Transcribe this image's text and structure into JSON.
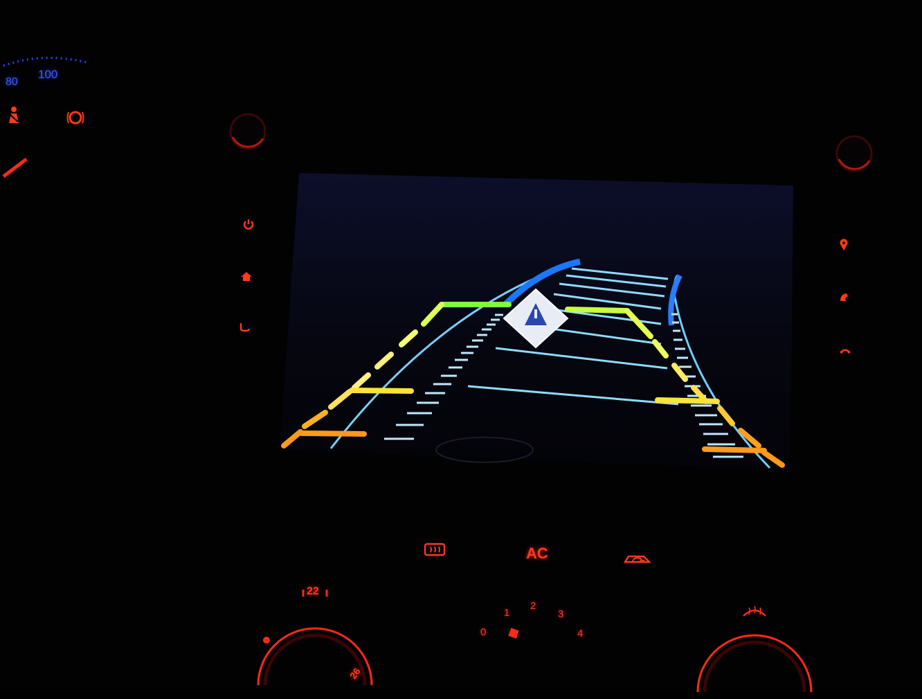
{
  "cluster": {
    "speed_labels": [
      "80",
      "100"
    ],
    "warning_icons": [
      "seatbelt-warning-icon",
      "brake-warning-icon"
    ]
  },
  "display": {
    "mode": "rear-camera-parking-guidelines",
    "guide_colors": {
      "near": "#ff9a1a",
      "mid": "#ffe23a",
      "far": "#7dff3a",
      "trajectory": "#2aa8ff"
    },
    "center_icon": "parking-warning-triangle-icon"
  },
  "left_buttons": [
    "power-icon",
    "home-icon",
    "back-icon"
  ],
  "right_buttons": [
    "map-pin-icon",
    "phone-icon",
    "hang-up-icon"
  ],
  "climate": {
    "rear_defrost_icon": "rear-defrost-icon",
    "ac_label": "AC",
    "recirculation_icon": "recirculation-icon",
    "temperature_label": "22",
    "temperature_max_label": "26",
    "fan_levels": [
      "0",
      "1",
      "2",
      "3",
      "4"
    ],
    "front_defrost_icon": "front-defrost-icon"
  },
  "colors": {
    "backlight": "#ff3a22",
    "cluster": "#3a5cff"
  }
}
